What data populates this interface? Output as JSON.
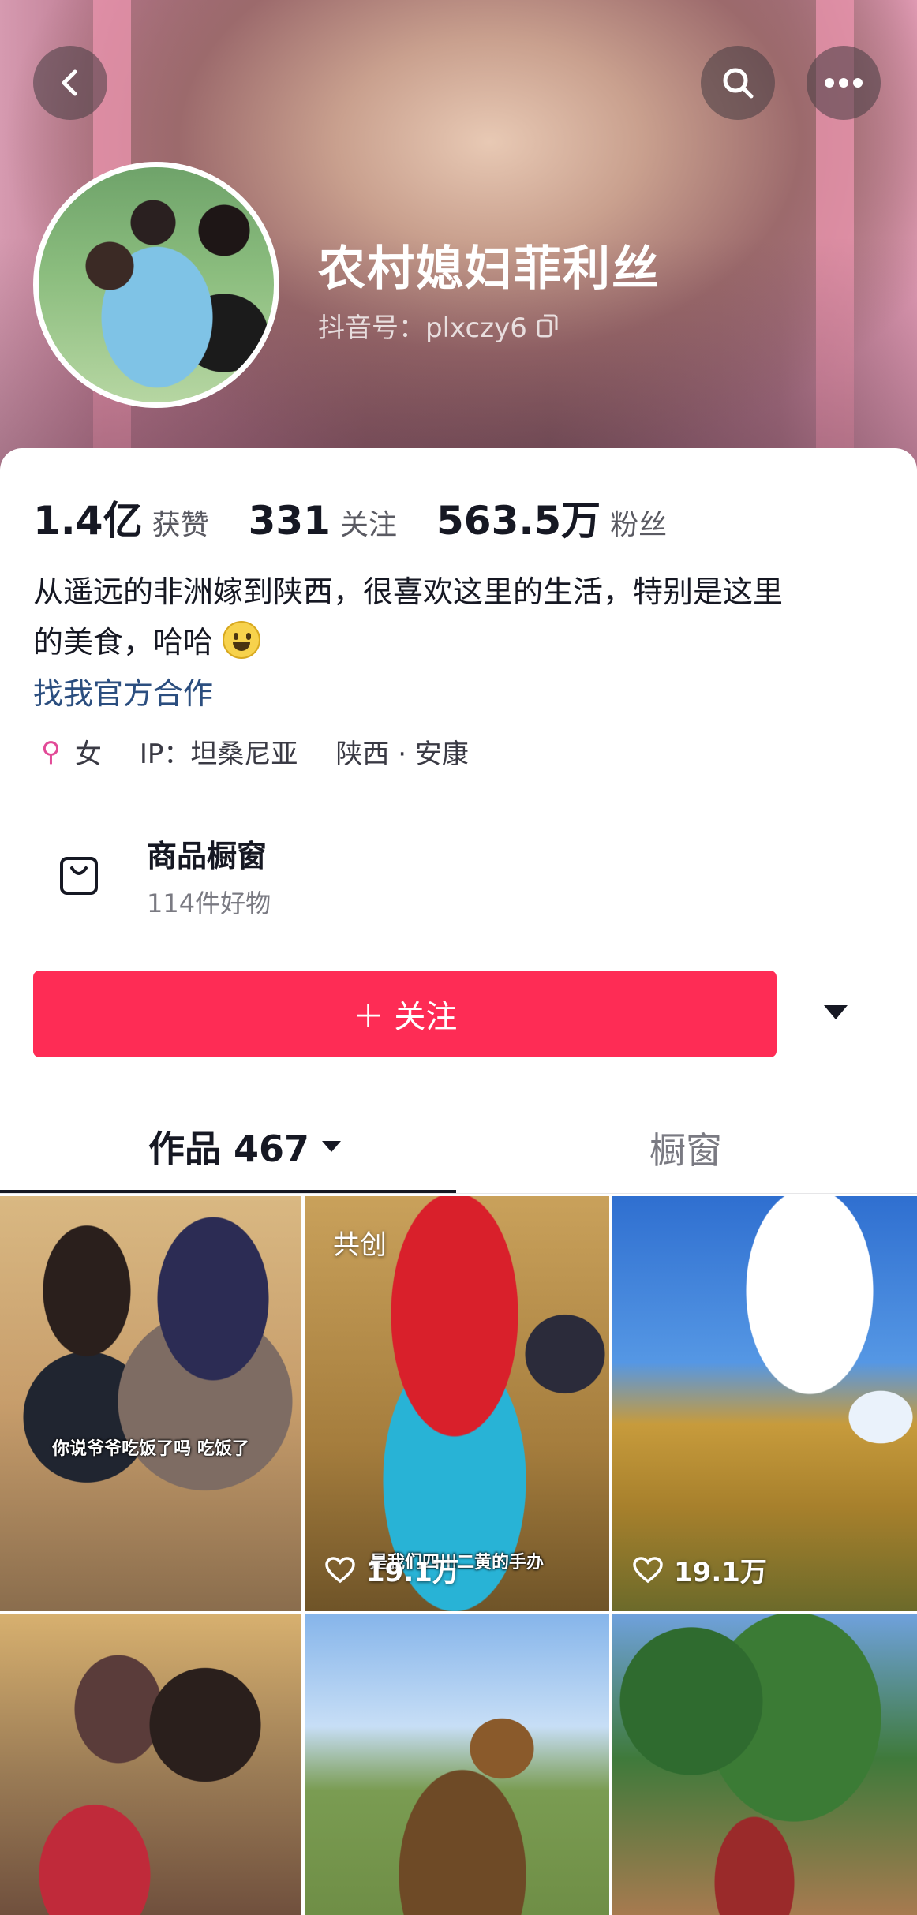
{
  "profile": {
    "name": "农村媳妇菲利丝",
    "douyin_id": "抖音号：plxczy6"
  },
  "stats": [
    {
      "value": "1.4亿",
      "label": "获赞"
    },
    {
      "value": "331",
      "label": "关注"
    },
    {
      "value": "563.5万",
      "label": "粉丝"
    }
  ],
  "bio": {
    "line1": "从遥远的非洲嫁到陕西，很喜欢这里的生活，特别是这里",
    "line2": "的美食，哈哈",
    "coop_link": "找我官方合作"
  },
  "meta": {
    "gender": "女",
    "ip": "IP：坦桑尼亚",
    "location": "陕西 · 安康"
  },
  "shop": {
    "title": "商品橱窗",
    "subtitle": "114件好物"
  },
  "follow": {
    "label": "＋ 关注"
  },
  "tabs": {
    "works": "作品 467",
    "shop": "橱窗"
  },
  "grid": [
    {
      "subtitle": "你说爷爷吃饭了吗 吃饭了",
      "likes": "",
      "badge": ""
    },
    {
      "subtitle": "是我们四川二黄的手办",
      "likes": "19.1万",
      "badge": "共创"
    },
    {
      "subtitle": "",
      "likes": "19.1万",
      "badge": ""
    },
    {
      "subtitle": "",
      "likes": "",
      "badge": ""
    },
    {
      "subtitle": "",
      "likes": "",
      "badge": ""
    },
    {
      "subtitle": "",
      "likes": "",
      "badge": ""
    }
  ],
  "icons": {
    "back": "back-arrow-icon",
    "search": "search-icon",
    "more": "more-dots-icon",
    "copy": "copy-icon",
    "gender": "female-icon",
    "shop": "shopping-bag-icon",
    "like": "heart-icon"
  },
  "colors": {
    "follow_button": "#fe2c55",
    "link": "#2b4e7f",
    "gender_icon": "#e24a97"
  }
}
